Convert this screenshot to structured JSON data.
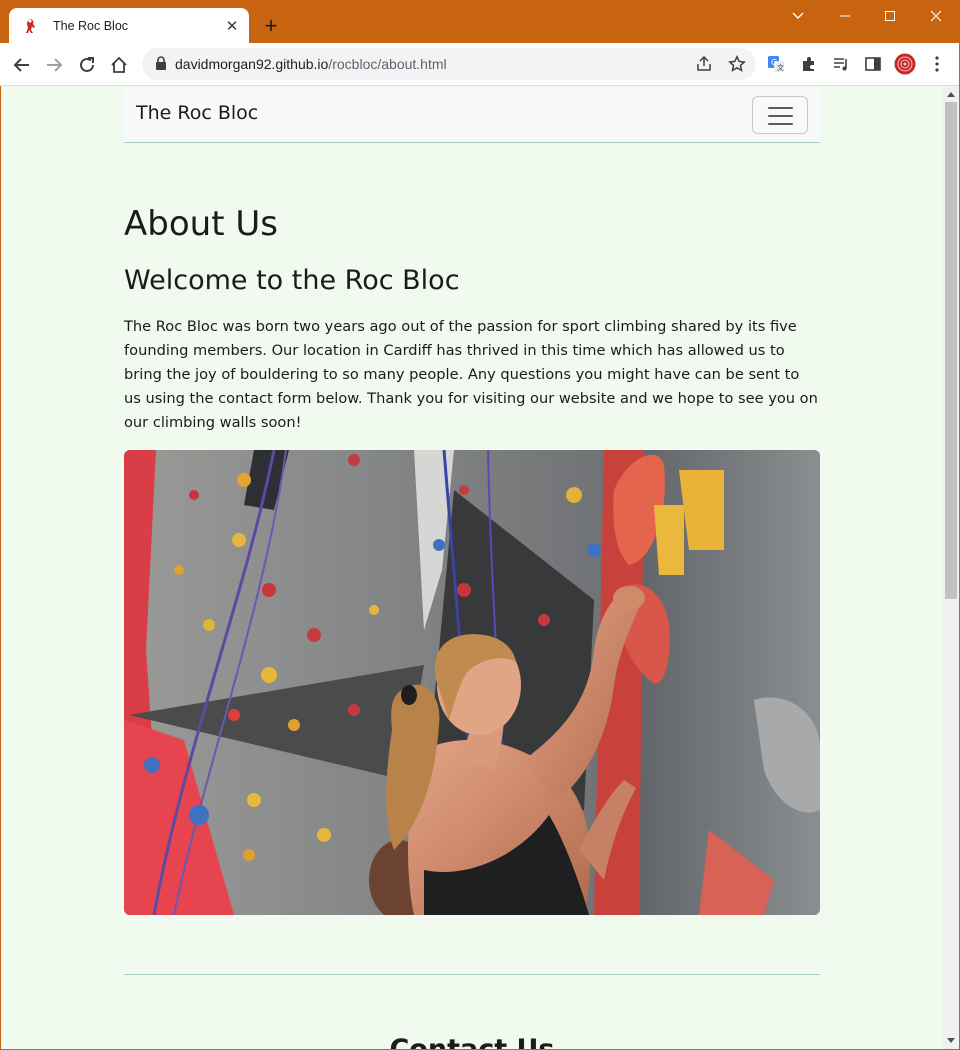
{
  "browser": {
    "tab_title": "The Roc Bloc",
    "url_host": "davidmorgan92.github.io",
    "url_path": "/rocbloc/about.html"
  },
  "site": {
    "brand": "The Roc Bloc",
    "heading": "About Us",
    "subheading": "Welcome to the Roc Bloc",
    "paragraph": "The Roc Bloc was born two years ago out of the passion for sport climbing shared by its five founding members. Our location in Cardiff has thrived in this time which has allowed us to bring the joy of bouldering to so many people. Any questions you might have can be sent to us using the contact form below. Thank you for visiting our website and we hope to see you on our climbing walls soon!",
    "next_heading": "Contact Us"
  },
  "colors": {
    "browser_frame": "#c8640f",
    "page_background": "#f0faee",
    "navbar_background": "#f8f9fa",
    "divider": "#9fd0c6"
  }
}
